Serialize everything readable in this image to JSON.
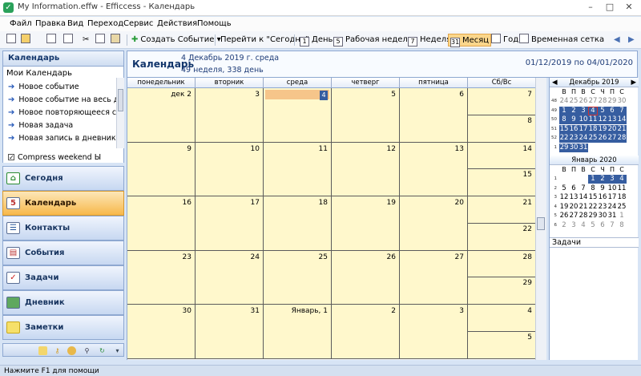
{
  "window": {
    "title": "My Information.effw - Efficcess - Календарь",
    "minimize": "–",
    "maximize": "□",
    "close": "✕"
  },
  "menu": [
    "Файл",
    "Правка",
    "Вид",
    "Переход",
    "Сервис",
    "Действия",
    "Помощь"
  ],
  "toolbar": {
    "create_event": "Создать Событие",
    "goto_today": "Перейти к \"Сегодня\"",
    "views": {
      "day": "День",
      "work_week": "Рабочая неделя",
      "week": "Неделя",
      "month": "Месяц",
      "year": "Год",
      "timeline": "Временная сетка"
    },
    "view_icons": {
      "day": "1",
      "work_week": "5",
      "week": "7",
      "month": "31"
    }
  },
  "sidebar": {
    "header": "Календарь",
    "my_calendar_title": "Мои Календарь",
    "quick_links": [
      "Новое событие",
      "Новое событие на весь ден",
      "Новое повторяющееся со",
      "Новая задача",
      "Новая запись в дневнике"
    ],
    "compress_weekend": "Compress weekend Ы",
    "nav": [
      {
        "label": "Сегодня",
        "icon": "home-icon"
      },
      {
        "label": "Календарь",
        "icon": "calendar-icon",
        "active": true
      },
      {
        "label": "Контакты",
        "icon": "contacts-icon"
      },
      {
        "label": "События",
        "icon": "events-icon"
      },
      {
        "label": "Задачи",
        "icon": "tasks-icon"
      },
      {
        "label": "Дневник",
        "icon": "diary-icon"
      },
      {
        "label": "Заметки",
        "icon": "notes-icon"
      }
    ]
  },
  "calendar": {
    "title": "Календарь",
    "date_line": "4 Декабрь 2019 г. среда",
    "week_line": "49 неделя, 338 день",
    "range": "01/12/2019 по 04/01/2020",
    "day_headers": [
      "понедельник",
      "вторник",
      "среда",
      "четверг",
      "пятница",
      "Сб/Вс"
    ],
    "weeks": [
      {
        "days": [
          "дек 2",
          "3",
          "4",
          "5",
          "6"
        ],
        "sat": "7",
        "sun": "8"
      },
      {
        "days": [
          "9",
          "10",
          "11",
          "12",
          "13"
        ],
        "sat": "14",
        "sun": "15"
      },
      {
        "days": [
          "16",
          "17",
          "18",
          "19",
          "20"
        ],
        "sat": "21",
        "sun": "22"
      },
      {
        "days": [
          "23",
          "24",
          "25",
          "26",
          "27"
        ],
        "sat": "28",
        "sun": "29"
      },
      {
        "days": [
          "30",
          "31",
          "Январь, 1",
          "2",
          "3"
        ],
        "sat": "4",
        "sun": "5"
      }
    ],
    "today_label": "4"
  },
  "mini_calendar": {
    "dow": [
      "В",
      "П",
      "В",
      "С",
      "Ч",
      "П",
      "С"
    ],
    "december": {
      "title": "Декабрь 2019",
      "weeks": [
        {
          "wk": "48",
          "days": [
            "24",
            "25",
            "26",
            "27",
            "28",
            "29",
            "30"
          ]
        },
        {
          "wk": "49",
          "days": [
            "1",
            "2",
            "3",
            "4",
            "5",
            "6",
            "7"
          ]
        },
        {
          "wk": "50",
          "days": [
            "8",
            "9",
            "10",
            "11",
            "12",
            "13",
            "14"
          ]
        },
        {
          "wk": "51",
          "days": [
            "15",
            "16",
            "17",
            "18",
            "19",
            "20",
            "21"
          ]
        },
        {
          "wk": "52",
          "days": [
            "22",
            "23",
            "24",
            "25",
            "26",
            "27",
            "28"
          ]
        },
        {
          "wk": "1",
          "days": [
            "29",
            "30",
            "31",
            "",
            "",
            "",
            ""
          ]
        }
      ]
    },
    "january": {
      "title": "Январь 2020",
      "weeks": [
        {
          "wk": "1",
          "days": [
            "",
            "",
            "",
            "1",
            "2",
            "3",
            "4"
          ]
        },
        {
          "wk": "2",
          "days": [
            "5",
            "6",
            "7",
            "8",
            "9",
            "10",
            "11"
          ]
        },
        {
          "wk": "3",
          "days": [
            "12",
            "13",
            "14",
            "15",
            "16",
            "17",
            "18"
          ]
        },
        {
          "wk": "4",
          "days": [
            "19",
            "20",
            "21",
            "22",
            "23",
            "24",
            "25"
          ]
        },
        {
          "wk": "5",
          "days": [
            "26",
            "27",
            "28",
            "29",
            "30",
            "31",
            "1"
          ]
        },
        {
          "wk": "6",
          "days": [
            "2",
            "3",
            "4",
            "5",
            "6",
            "7",
            "8"
          ]
        }
      ]
    },
    "tasks_title": "Задачи"
  },
  "status": "Нажмите F1 для помощи",
  "colors": {
    "cell_bg": "#fff8cc",
    "selected": "#365da0",
    "active_nav": "#f7b84a"
  }
}
